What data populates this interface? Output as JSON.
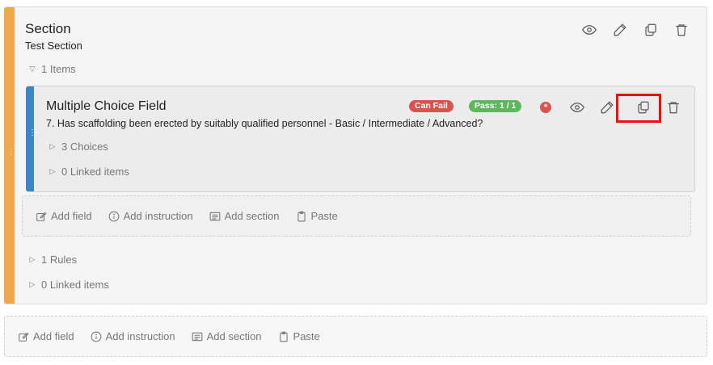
{
  "section": {
    "title": "Section",
    "subtitle": "Test Section",
    "items_toggle": "1 Items",
    "rules_toggle": "1 Rules",
    "linked_toggle": "0 Linked items"
  },
  "field": {
    "title": "Multiple Choice Field",
    "question": "7. Has scaffolding been erected by suitably qualified personnel - Basic / Intermediate / Advanced?",
    "badge_fail": "Can Fail",
    "badge_pass": "Pass: 1 / 1",
    "required_mark": "*",
    "choices_toggle": "3 Choices",
    "linked_toggle": "0 Linked items"
  },
  "add_bar": {
    "add_field": "Add field",
    "add_instruction": "Add instruction",
    "add_section": "Add section",
    "paste": "Paste"
  },
  "colors": {
    "section_accent": "#f0a84a",
    "field_accent": "#3b86c6",
    "fail": "#d9534f",
    "pass": "#5cb85c",
    "highlight": "#e8130c"
  },
  "icons": [
    "eye-icon",
    "pencil-icon",
    "copy-icon",
    "trash-icon",
    "edit-field-icon",
    "info-icon",
    "section-icon",
    "clipboard-icon"
  ]
}
